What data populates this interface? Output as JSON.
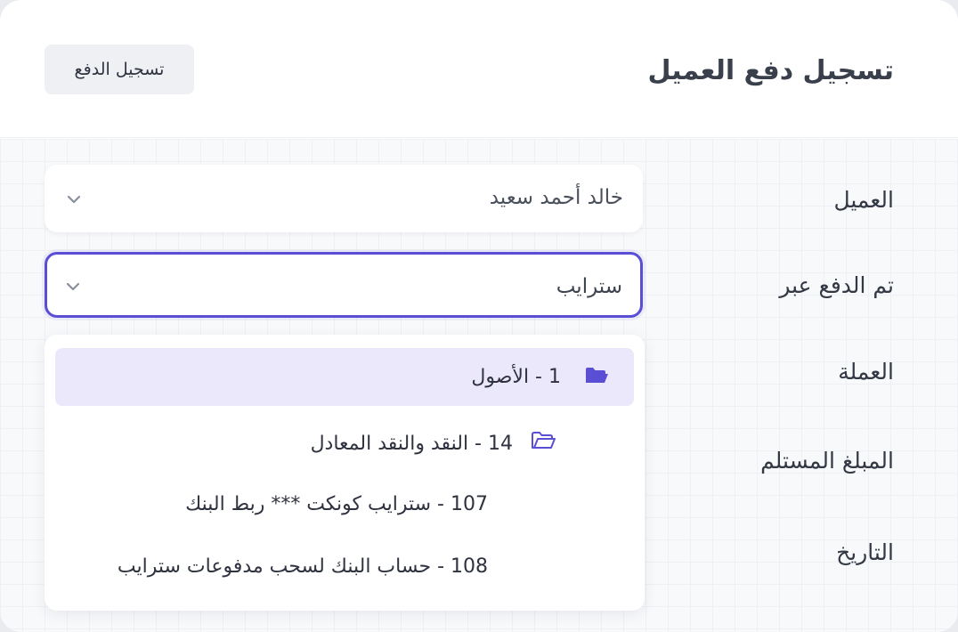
{
  "header": {
    "title": "تسجيل دفع العميل",
    "button_label": "تسجيل الدفع"
  },
  "form": {
    "labels": {
      "client": "العميل",
      "paid_via": "تم الدفع عبر",
      "currency": "العملة",
      "amount_received": "المبلغ المستلم",
      "date": "التاريخ"
    },
    "client_value": "خالد أحمد سعيد",
    "paid_via_value": "سترايب"
  },
  "dropdown": {
    "options": [
      {
        "label": "1 - الأصول",
        "icon": "folder-open-icon",
        "level": 0,
        "selected": true
      },
      {
        "label": "14 - النقد والنقد المعادل",
        "icon": "folder-open-icon",
        "level": 1,
        "selected": false
      },
      {
        "label": "107 - سترايب كونكت *** ربط البنك",
        "icon": "",
        "level": 2,
        "selected": false
      },
      {
        "label": "108 - حساب البنك لسحب مدفوعات سترايب",
        "icon": "",
        "level": 2,
        "selected": false
      }
    ]
  },
  "colors": {
    "accent": "#5a4fd4",
    "selected_bg": "#ebe8fb",
    "folder_icon": "#5a4fd4"
  }
}
